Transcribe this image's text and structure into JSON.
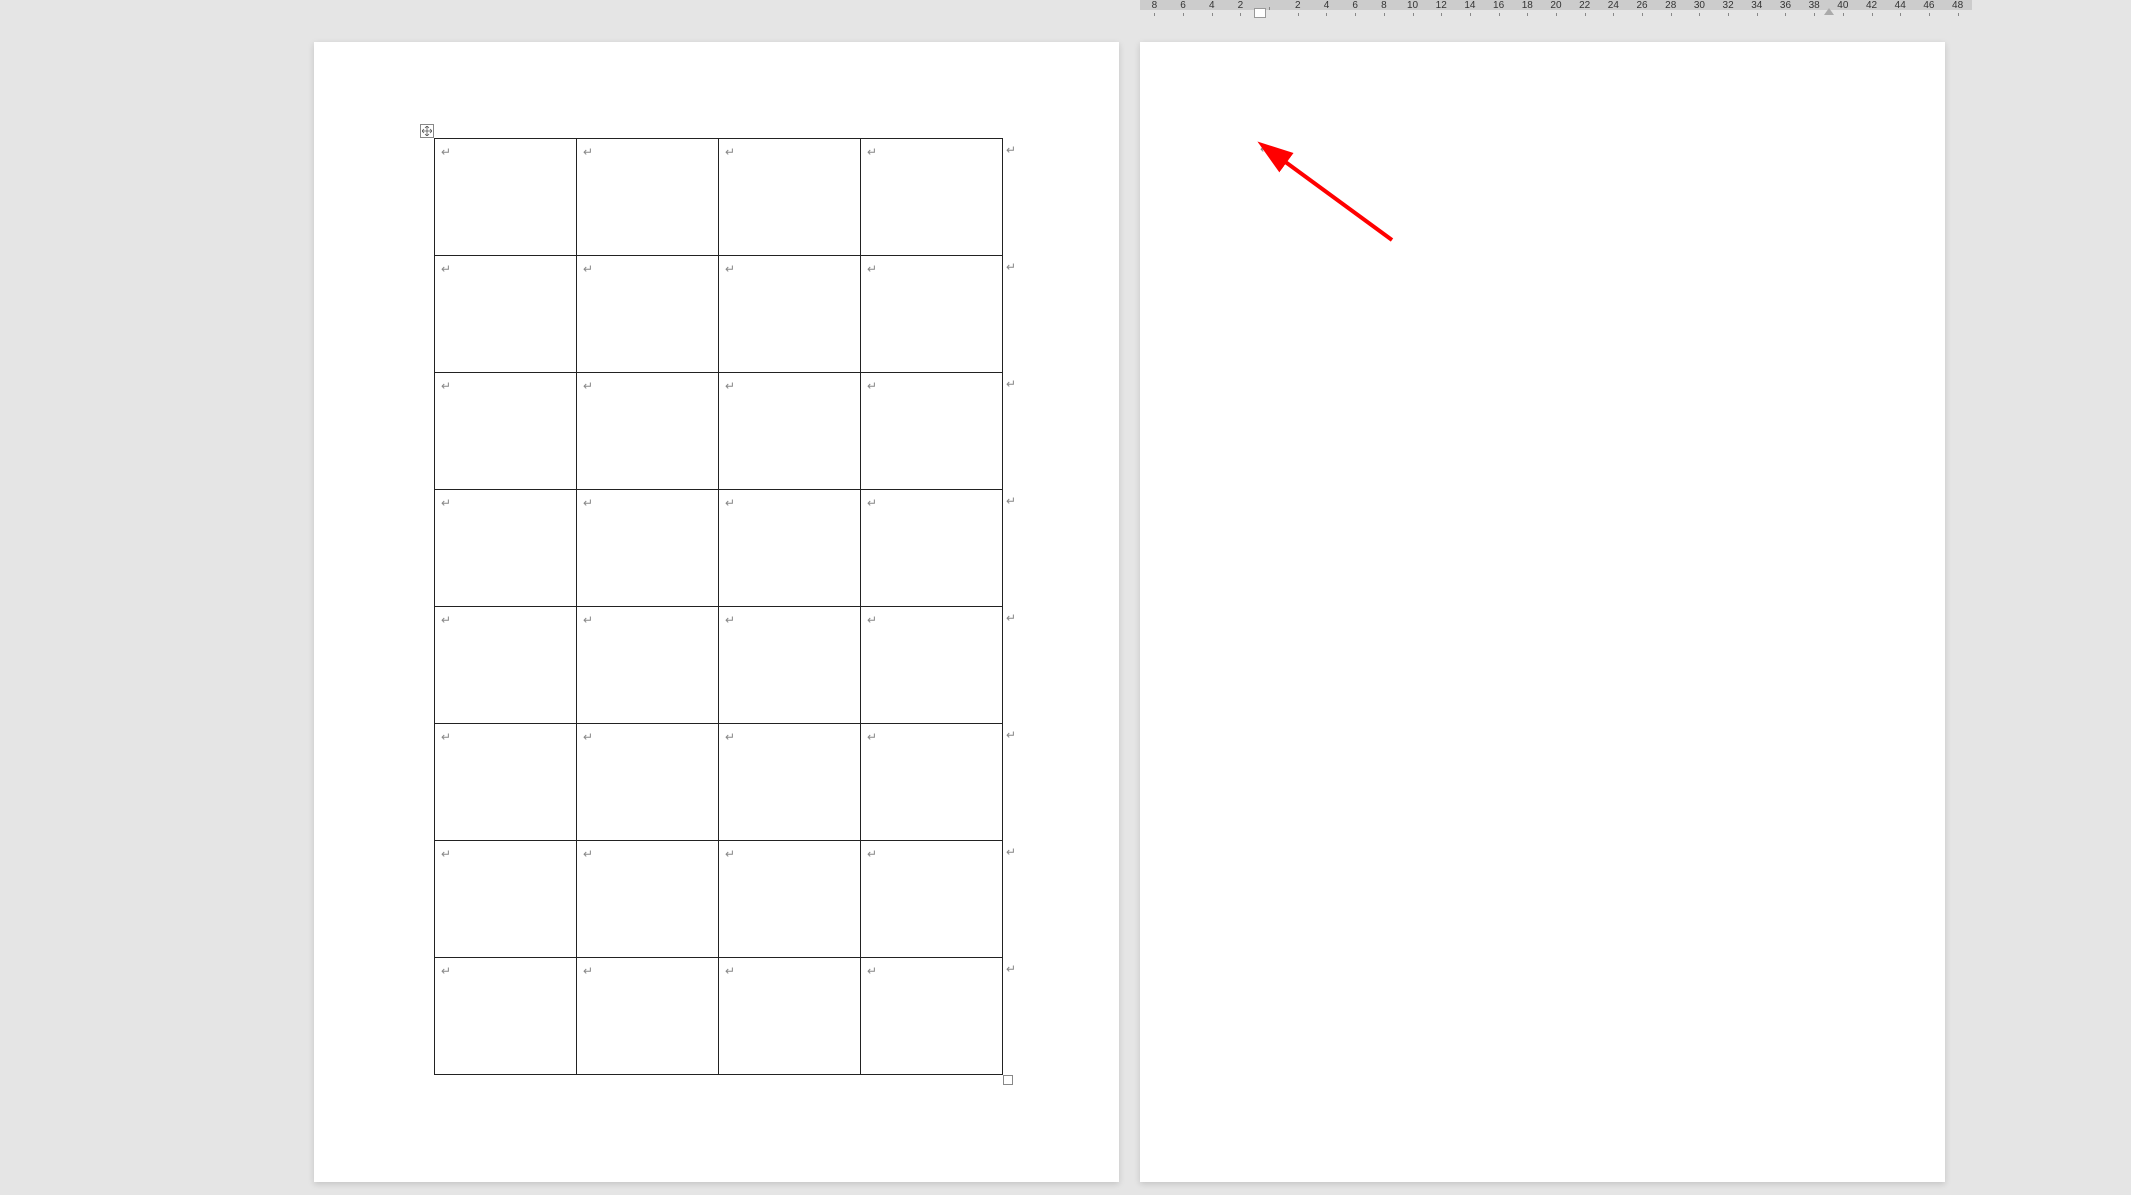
{
  "ruler": {
    "ticks": [
      "8",
      "6",
      "4",
      "2",
      "",
      "2",
      "4",
      "6",
      "8",
      "10",
      "12",
      "14",
      "16",
      "18",
      "20",
      "22",
      "24",
      "26",
      "28",
      "30",
      "32",
      "34",
      "36",
      "38",
      "40",
      "42",
      "44",
      "46",
      "48"
    ]
  },
  "glyphs": {
    "para_mark": "↵",
    "row_end": "↵"
  },
  "table": {
    "rows": 8,
    "cols": 4
  },
  "annotation": {
    "color": "#ff0000"
  }
}
